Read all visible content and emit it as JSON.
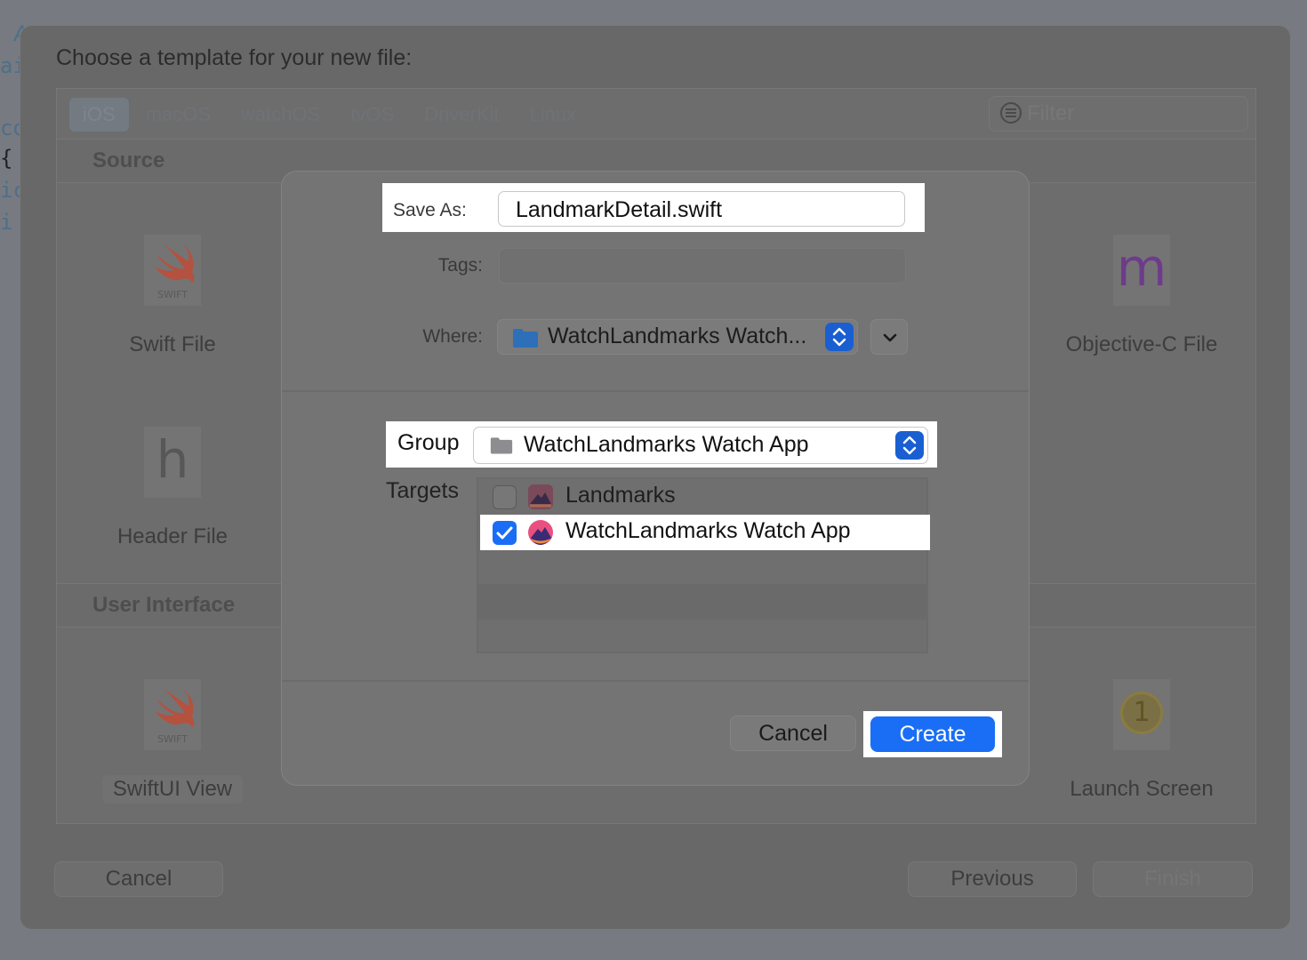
{
  "editor": {
    "code_lines": [
      "A",
      "ai",
      "co",
      "{",
      "ic",
      "i"
    ]
  },
  "template_chooser": {
    "title": "Choose a template for your new file:",
    "platform_tabs": [
      "iOS",
      "macOS",
      "watchOS",
      "tvOS",
      "DriverKit",
      "Linux"
    ],
    "active_tab": "iOS",
    "filter_placeholder": "Filter",
    "sections": {
      "source": "Source",
      "user_interface": "User Interface"
    },
    "templates": {
      "swift_file": {
        "label": "Swift File",
        "badge": "SWIFT"
      },
      "objc_file": {
        "label": "Objective-C File",
        "glyph": "m"
      },
      "header_file": {
        "label": "Header File",
        "glyph": "h"
      },
      "swiftui_view": {
        "label": "SwiftUI View",
        "badge": "SWIFT"
      },
      "launch_screen": {
        "label": "Launch Screen",
        "glyph": "1"
      }
    },
    "buttons": {
      "cancel": "Cancel",
      "previous": "Previous",
      "finish": "Finish"
    }
  },
  "save_dialog": {
    "save_as_label": "Save As:",
    "save_as_value": "LandmarkDetail.swift",
    "tags_label": "Tags:",
    "tags_value": "",
    "where_label": "Where:",
    "where_value": "WatchLandmarks Watch...",
    "group_label": "Group",
    "group_value": "WatchLandmarks Watch App",
    "targets_label": "Targets",
    "targets": [
      {
        "name": "Landmarks",
        "checked": false
      },
      {
        "name": "WatchLandmarks Watch App",
        "checked": true
      }
    ],
    "cancel_label": "Cancel",
    "create_label": "Create"
  },
  "colors": {
    "accent": "#1a6ef5",
    "swift_orange": "#e8553c",
    "objc_purple": "#7c3fa0"
  },
  "icons": [
    "folder-icon",
    "popup-stepper-icon",
    "chevron-down-icon",
    "filter-icon",
    "swift-logo-icon",
    "app-icon-landmarks",
    "app-icon-watch"
  ]
}
